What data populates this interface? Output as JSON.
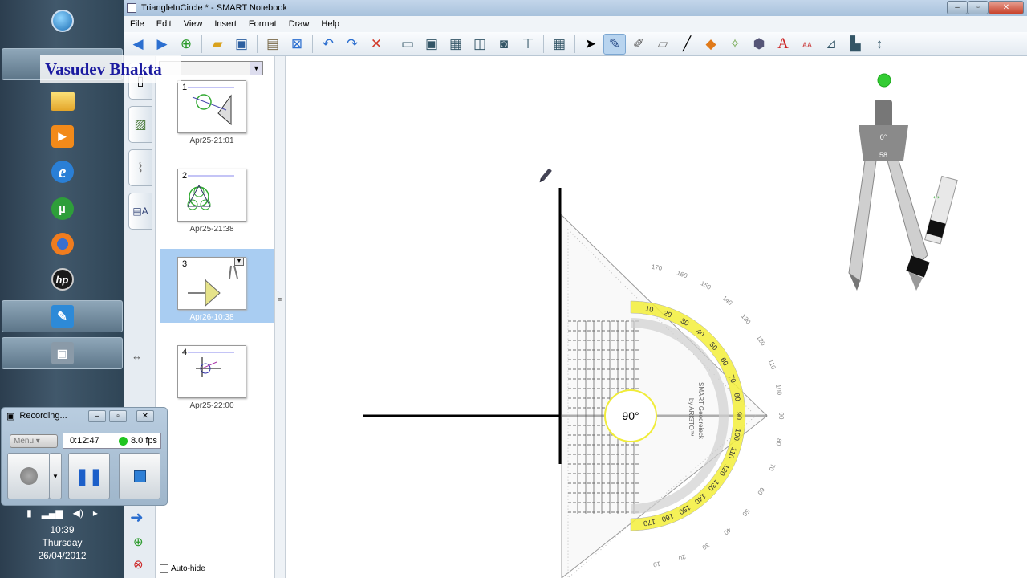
{
  "watermark": "Vasudev Bhakta",
  "taskbar": {
    "icons": [
      "windows-orb",
      "file-explorer",
      "media-player",
      "internet-explorer",
      "utorrent",
      "firefox",
      "hp",
      "smart-notebook",
      "camera-recorder"
    ],
    "tray": {
      "time": "10:39",
      "day": "Thursday",
      "date": "26/04/2012"
    }
  },
  "recorder": {
    "title": "Recording...",
    "menu": "Menu",
    "elapsed": "0:12:47",
    "fps": "8.0 fps"
  },
  "window": {
    "title": "TriangleInCircle * - SMART Notebook",
    "menu": [
      "File",
      "Edit",
      "View",
      "Insert",
      "Format",
      "Draw",
      "Help"
    ]
  },
  "sorter": {
    "pages": [
      {
        "num": "1",
        "date": "Apr25-21:01"
      },
      {
        "num": "2",
        "date": "Apr25-21:38"
      },
      {
        "num": "3",
        "date": "Apr26-10:38"
      },
      {
        "num": "4",
        "date": "Apr25-22:00"
      }
    ],
    "selected_page": "3",
    "autohide_label": "Auto-hide"
  },
  "canvas": {
    "angle_readout": "90°",
    "compass_angle": "0°",
    "compass_radius": "58",
    "protractor_brand1": "SMART Geodreieck",
    "protractor_brand2": "by ARISTO™",
    "inner_scale": [
      "10",
      "20",
      "30",
      "40",
      "50",
      "60",
      "70",
      "80",
      "90",
      "100",
      "110",
      "120",
      "130",
      "140",
      "150",
      "160",
      "170"
    ],
    "outer_scale": [
      "170",
      "160",
      "150",
      "140",
      "130",
      "120",
      "110",
      "100",
      "90",
      "80",
      "70",
      "60",
      "50",
      "40",
      "30",
      "20",
      "10"
    ]
  },
  "colors": {
    "accent_yellow": "#f3ef3a",
    "selection_blue": "#a9cdf2",
    "compass_green": "#33bb33"
  }
}
